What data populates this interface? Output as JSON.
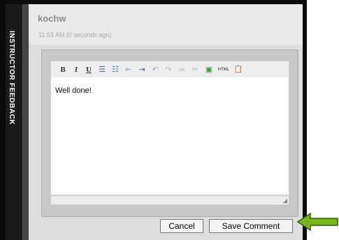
{
  "sidebar": {
    "tab_label": "INSTRUCTOR FEEDBACK"
  },
  "comment": {
    "author": "kochw",
    "timestamp": "11:53 AM (0 seconds ago)",
    "body": "Well done!"
  },
  "toolbar": {
    "items": [
      {
        "name": "bold",
        "glyph": "B"
      },
      {
        "name": "italic",
        "glyph": "I"
      },
      {
        "name": "underline",
        "glyph": "U"
      },
      {
        "name": "bullet-list",
        "glyph": "☰"
      },
      {
        "name": "numbered-list",
        "glyph": "☷"
      },
      {
        "name": "outdent",
        "glyph": "⇤"
      },
      {
        "name": "indent",
        "glyph": "⇥"
      },
      {
        "name": "undo",
        "glyph": "↶"
      },
      {
        "name": "redo",
        "glyph": "↷"
      },
      {
        "name": "link",
        "glyph": "∞"
      },
      {
        "name": "unlink",
        "glyph": "✂"
      },
      {
        "name": "image",
        "glyph": "▣"
      },
      {
        "name": "html",
        "glyph": "HTML"
      },
      {
        "name": "paste",
        "glyph": "📋"
      }
    ]
  },
  "buttons": {
    "cancel": "Cancel",
    "save": "Save Comment"
  },
  "colors": {
    "arrow": "#7ab51d",
    "arrow_border": "#2f5f0a"
  }
}
